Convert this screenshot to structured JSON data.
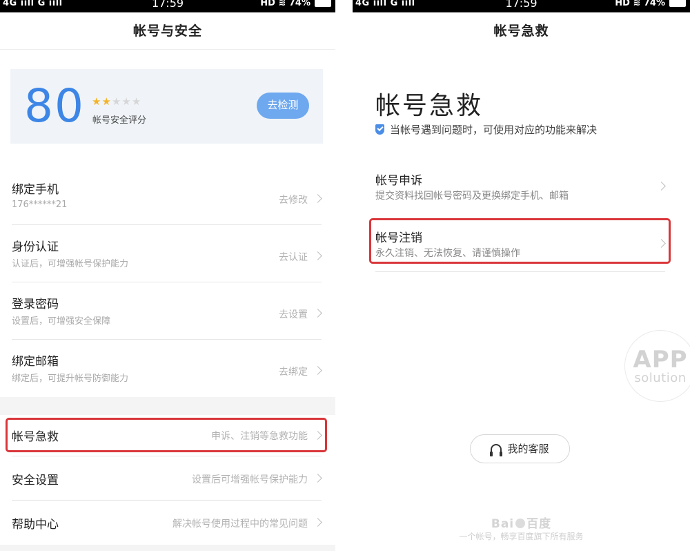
{
  "left": {
    "status": {
      "network": "4G ııll G ııll",
      "time": "17:59",
      "right": "HD ≋ 74%"
    },
    "nav_title": "帐号与安全",
    "score": {
      "value": "80",
      "stars_filled": 2,
      "stars_total": 5,
      "label": "帐号安全评分",
      "button": "去检测"
    },
    "items": [
      {
        "title": "绑定手机",
        "sub": "176******21",
        "action": "去修改"
      },
      {
        "title": "身份认证",
        "sub": "认证后，可增强帐号保护能力",
        "action": "去认证"
      },
      {
        "title": "登录密码",
        "sub": "设置后，可增强安全保障",
        "action": "去设置"
      },
      {
        "title": "绑定邮箱",
        "sub": "绑定后，可提升帐号防御能力",
        "action": "去绑定"
      }
    ],
    "rescue": {
      "title": "帐号急救",
      "action": "申诉、注销等急救功能"
    },
    "security": {
      "title": "安全设置",
      "action": "设置后可增强帐号保护能力"
    },
    "help": {
      "title": "帮助中心",
      "action": "解决帐号使用过程中的常见问题"
    },
    "highlight_color": "#d9363a"
  },
  "right": {
    "status": {
      "network": "4G ııll G ııll",
      "time": "17:59",
      "right": "HD ≋ 74%"
    },
    "nav_title": "帐号急救",
    "big_title": "帐号急救",
    "tip": "当帐号遇到问题时，可使用对应的功能来解决",
    "appeal": {
      "title": "帐号申诉",
      "sub": "提交资料找回帐号密码及更换绑定手机、邮箱"
    },
    "cancel": {
      "title": "帐号注销",
      "sub": "永久注销、无法恢复、请谨慎操作"
    },
    "service_button": "我的客服",
    "logo_text_left": "Bai",
    "logo_text_right": "百度",
    "slogan": "一个帐号，畅享百度旗下所有服务"
  },
  "watermark": {
    "line1": "APP",
    "line2": "solution"
  }
}
